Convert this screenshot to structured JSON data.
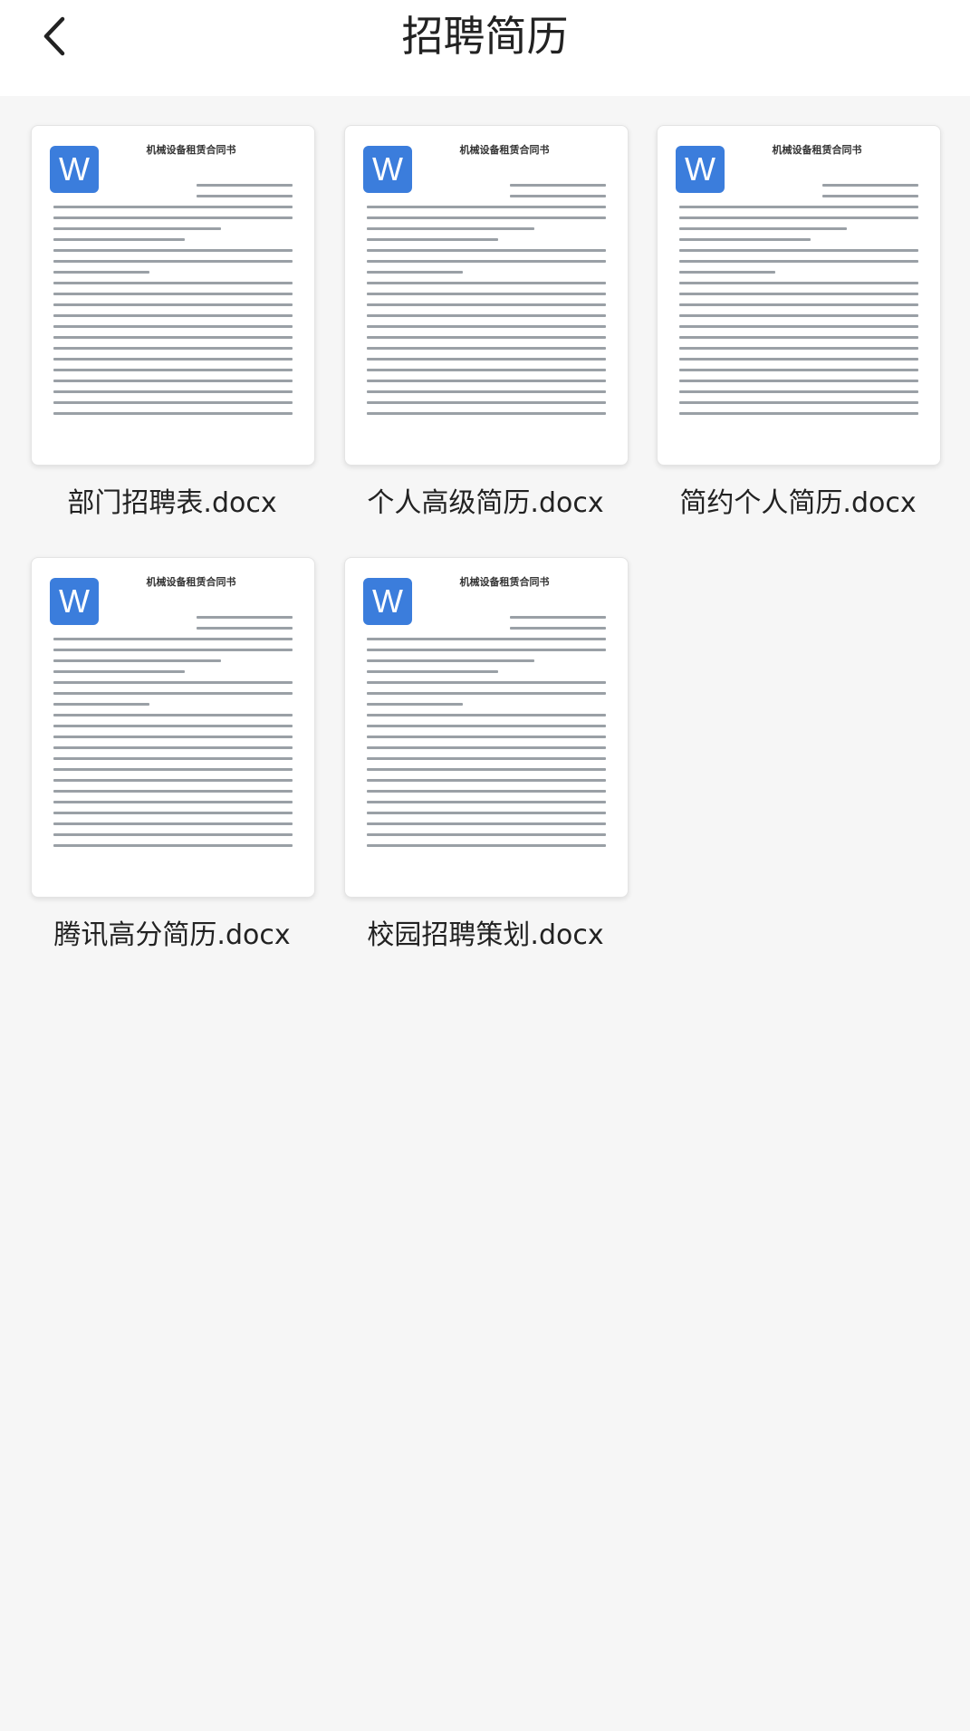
{
  "header": {
    "title": "招聘简历",
    "back_icon": "chevron-left-icon"
  },
  "files": [
    {
      "name": "部门招聘表.docx",
      "preview_title": "机械设备租赁合同书",
      "badge": "W"
    },
    {
      "name": "个人高级简历.docx",
      "preview_title": "机械设备租赁合同书",
      "badge": "W"
    },
    {
      "name": "简约个人简历.docx",
      "preview_title": "机械设备租赁合同书",
      "badge": "W"
    },
    {
      "name": "腾讯高分简历.docx",
      "preview_title": "机械设备租赁合同书",
      "badge": "W"
    },
    {
      "name": "校园招聘策划.docx",
      "preview_title": "机械设备租赁合同书",
      "badge": "W"
    }
  ],
  "colors": {
    "accent": "#3b7ddc",
    "background": "#f6f6f6",
    "header": "#ffffff"
  }
}
